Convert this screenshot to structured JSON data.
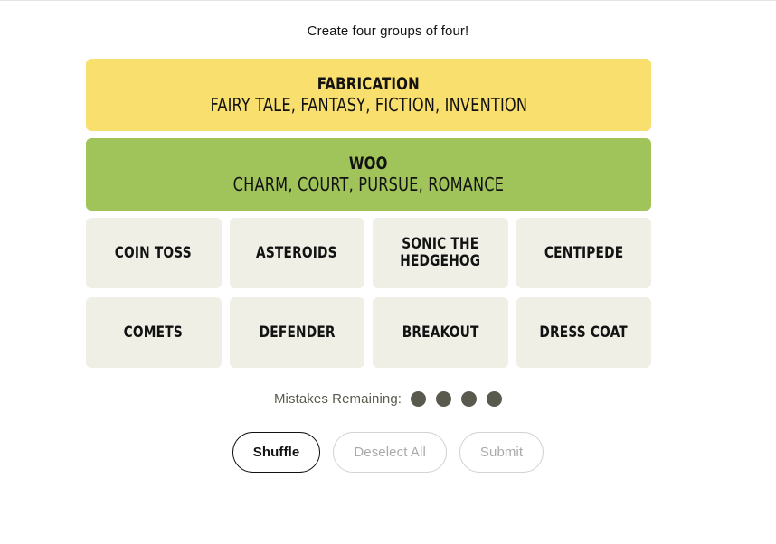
{
  "instruction": "Create four groups of four!",
  "colors": {
    "yellow": "#f9df6d",
    "green": "#a0c35a",
    "tile": "#efefe6",
    "tile_text": "#121212",
    "dot": "#5a594e",
    "page_bg": "#ffffff",
    "button_enabled_border": "#121212",
    "button_disabled_border": "#d3d3d3",
    "button_disabled_text": "#aaaaaa"
  },
  "solved_groups": [
    {
      "title": "FABRICATION",
      "members_text": "FAIRY TALE, FANTASY, FICTION, INVENTION",
      "members": [
        "FAIRY TALE",
        "FANTASY",
        "FICTION",
        "INVENTION"
      ],
      "color": "#f9df6d",
      "difficulty": "yellow"
    },
    {
      "title": "WOO",
      "members_text": "CHARM, COURT, PURSUE, ROMANCE",
      "members": [
        "CHARM",
        "COURT",
        "PURSUE",
        "ROMANCE"
      ],
      "color": "#a0c35a",
      "difficulty": "green"
    }
  ],
  "tiles": [
    {
      "label": "COIN TOSS",
      "selected": false
    },
    {
      "label": "ASTEROIDS",
      "selected": false
    },
    {
      "label": "SONIC THE HEDGEHOG",
      "selected": false
    },
    {
      "label": "CENTIPEDE",
      "selected": false
    },
    {
      "label": "COMETS",
      "selected": false
    },
    {
      "label": "DEFENDER",
      "selected": false
    },
    {
      "label": "BREAKOUT",
      "selected": false
    },
    {
      "label": "DRESS COAT",
      "selected": false
    }
  ],
  "mistakes": {
    "label": "Mistakes Remaining:",
    "remaining": 4,
    "dots": [
      1,
      2,
      3,
      4
    ]
  },
  "buttons": [
    {
      "label": "Shuffle",
      "state": "enabled"
    },
    {
      "label": "Deselect All",
      "state": "disabled"
    },
    {
      "label": "Submit",
      "state": "disabled"
    }
  ]
}
